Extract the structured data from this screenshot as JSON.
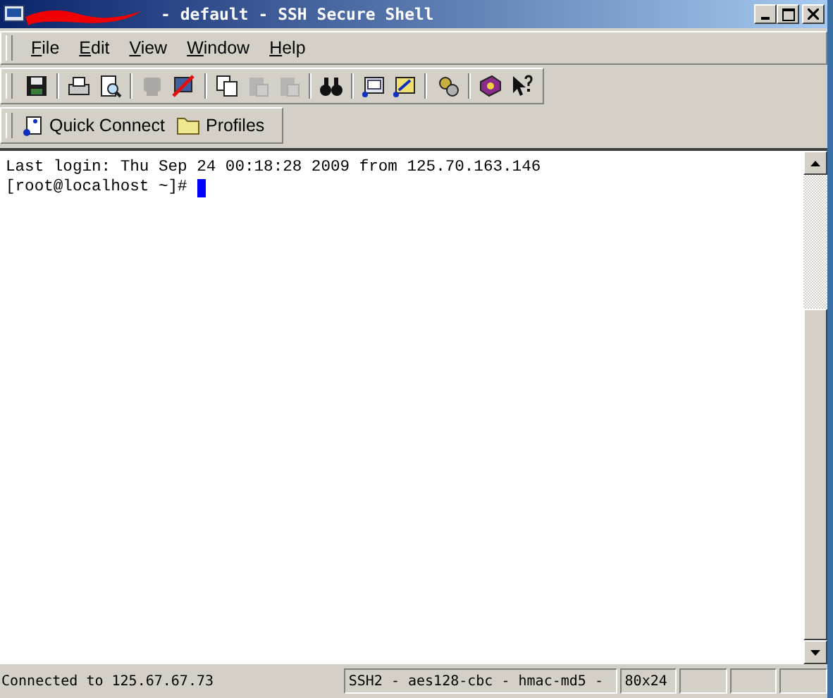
{
  "window": {
    "title": "- default - SSH Secure Shell"
  },
  "menu": [
    {
      "label": "File"
    },
    {
      "label": "Edit"
    },
    {
      "label": "View"
    },
    {
      "label": "Window"
    },
    {
      "label": "Help"
    }
  ],
  "toolbar": {
    "groups": [
      [
        {
          "kind": "save",
          "disabled": false
        }
      ],
      [
        {
          "kind": "print",
          "disabled": false
        },
        {
          "kind": "preview",
          "disabled": false
        }
      ],
      [
        {
          "kind": "connect",
          "disabled": true
        },
        {
          "kind": "disconnect",
          "disabled": false
        }
      ],
      [
        {
          "kind": "copy",
          "disabled": false
        },
        {
          "kind": "paste",
          "disabled": true
        },
        {
          "kind": "paste",
          "disabled": true
        }
      ],
      [
        {
          "kind": "find",
          "disabled": false
        }
      ],
      [
        {
          "kind": "terminal",
          "disabled": false
        },
        {
          "kind": "transfer",
          "disabled": false
        }
      ],
      [
        {
          "kind": "settings",
          "disabled": false
        }
      ],
      [
        {
          "kind": "help",
          "disabled": false
        },
        {
          "kind": "whatsthis",
          "disabled": false
        }
      ]
    ]
  },
  "quickbar": [
    {
      "kind": "connect",
      "label": "Quick Connect"
    },
    {
      "kind": "folder",
      "label": "Profiles"
    }
  ],
  "terminal": {
    "lines": [
      "Last login: Thu Sep 24 00:18:28 2009 from 125.70.163.146"
    ],
    "prompt": "[root@localhost ~]# "
  },
  "status_bar": [
    "Connected to 125.67.67.73",
    "SSH2 - aes128-cbc - hmac-md5 - ",
    "80x24"
  ]
}
